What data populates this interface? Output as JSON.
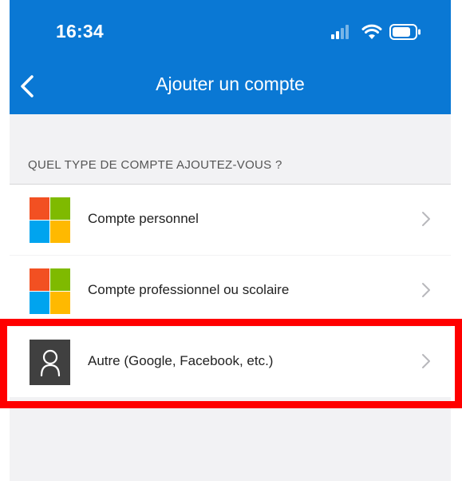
{
  "status_bar": {
    "time": "16:34"
  },
  "nav": {
    "title": "Ajouter un compte"
  },
  "section": {
    "label": "QUEL TYPE DE COMPTE AJOUTEZ-VOUS ?"
  },
  "accounts": [
    {
      "label": "Compte personnel",
      "icon": "microsoft-logo-icon"
    },
    {
      "label": "Compte professionnel ou scolaire",
      "icon": "microsoft-logo-icon"
    },
    {
      "label": "Autre (Google, Facebook, etc.)",
      "icon": "person-icon",
      "highlighted": true
    }
  ],
  "colors": {
    "header_blue": "#0a78d4",
    "highlight_red": "#ff0000",
    "ms_red": "#f25022",
    "ms_green": "#7fba00",
    "ms_blue": "#00a4ef",
    "ms_yellow": "#ffb900"
  }
}
